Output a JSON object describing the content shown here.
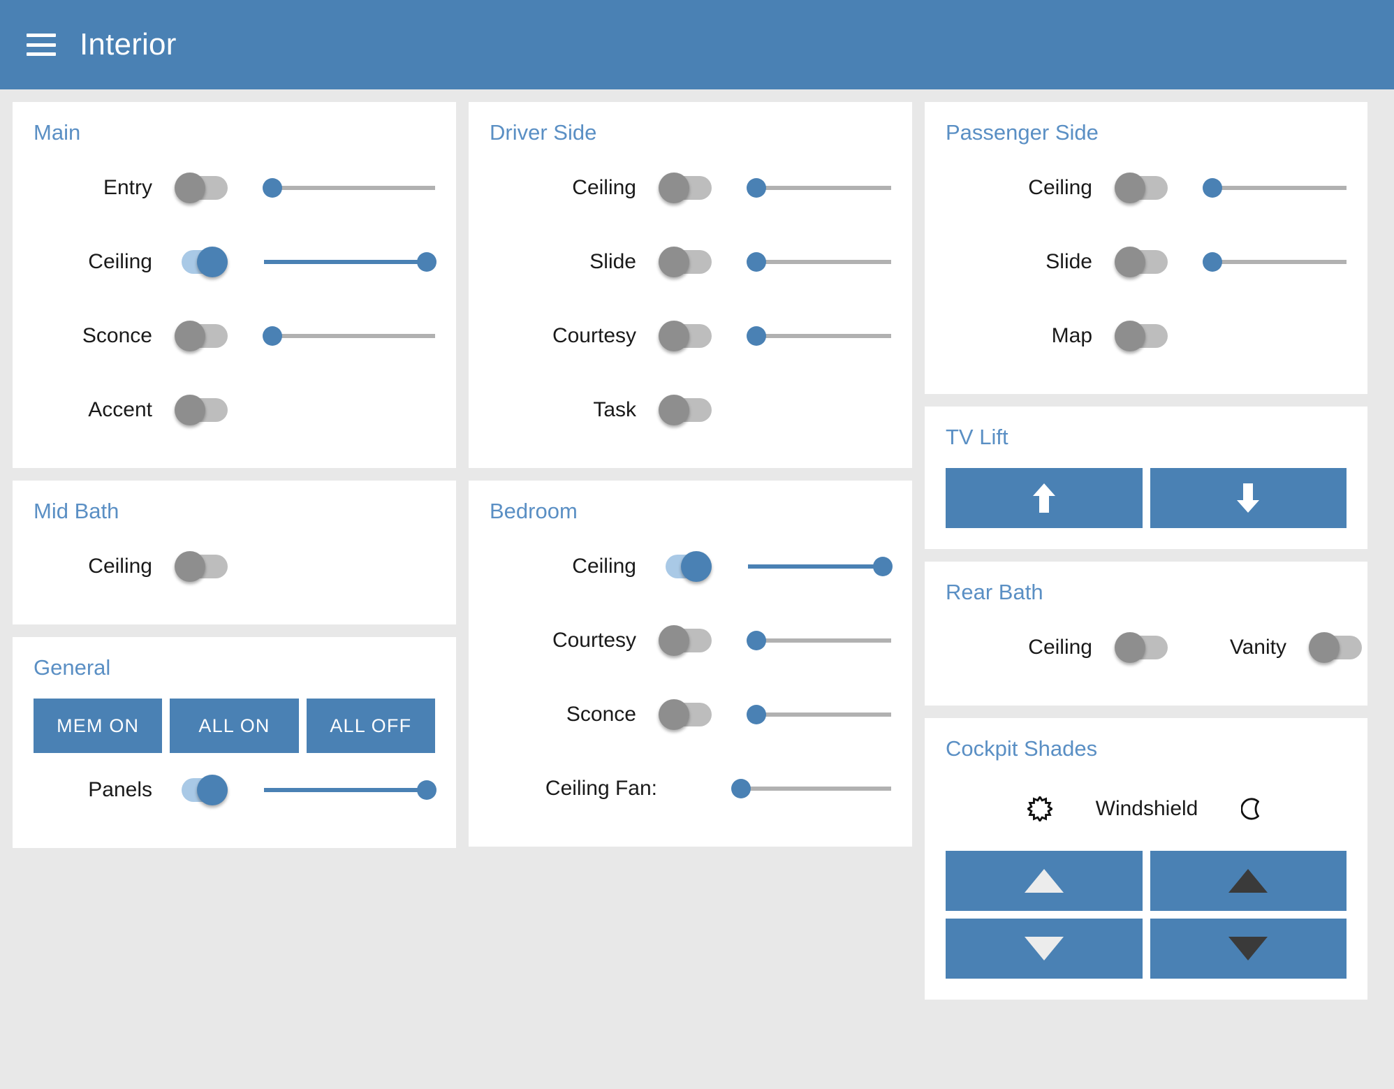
{
  "appbar": {
    "title": "Interior",
    "menu_icon": "hamburger-menu-icon",
    "background": "#4a81b4"
  },
  "theme": {
    "accent": "#4a81b4",
    "card_title_color": "#5a8fc4",
    "page_background": "#e8e8e8",
    "card_background": "#ffffff",
    "toggle_off_knob": "#8e8e8e",
    "toggle_off_track": "#bdbdbd",
    "toggle_on_knob": "#4a81b4",
    "toggle_on_track": "#a9c9e6",
    "slider_track": "#b1b1b1"
  },
  "cards": {
    "main": {
      "title": "Main",
      "rows": [
        {
          "label": "Entry",
          "toggle": "off",
          "toggle_state_text": "off",
          "slider": "min",
          "slider_value": 0
        },
        {
          "label": "Ceiling",
          "toggle": "on",
          "toggle_state_text": "on",
          "slider": "max",
          "slider_value": 100
        },
        {
          "label": "Sconce",
          "toggle": "off",
          "toggle_state_text": "off",
          "slider": "min",
          "slider_value": 0
        },
        {
          "label": "Accent",
          "toggle": "off",
          "toggle_state_text": "off",
          "slider": "none",
          "slider_value": null
        }
      ]
    },
    "mid_bath": {
      "title": "Mid Bath",
      "rows": [
        {
          "label": "Ceiling",
          "toggle": "off",
          "toggle_state_text": "off",
          "slider": "none",
          "slider_value": null
        }
      ]
    },
    "general": {
      "title": "General",
      "buttons": [
        {
          "label": "MEM ON"
        },
        {
          "label": "ALL ON"
        },
        {
          "label": "ALL OFF"
        }
      ],
      "rows": [
        {
          "label": "Panels",
          "toggle": "on",
          "toggle_state_text": "on",
          "slider": "max",
          "slider_value": 100
        }
      ]
    },
    "driver_side": {
      "title": "Driver Side",
      "rows": [
        {
          "label": "Ceiling",
          "toggle": "off",
          "toggle_state_text": "off",
          "slider": "min",
          "slider_value": 0
        },
        {
          "label": "Slide",
          "toggle": "off",
          "toggle_state_text": "off",
          "slider": "min",
          "slider_value": 0
        },
        {
          "label": "Courtesy",
          "toggle": "off",
          "toggle_state_text": "off",
          "slider": "min",
          "slider_value": 0
        },
        {
          "label": "Task",
          "toggle": "off",
          "toggle_state_text": "off",
          "slider": "none",
          "slider_value": null
        }
      ]
    },
    "bedroom": {
      "title": "Bedroom",
      "rows": [
        {
          "label": "Ceiling",
          "toggle": "on",
          "toggle_state_text": "on",
          "slider": "max",
          "slider_value": 100
        },
        {
          "label": "Courtesy",
          "toggle": "off",
          "toggle_state_text": "off",
          "slider": "min",
          "slider_value": 0
        },
        {
          "label": "Sconce",
          "toggle": "off",
          "toggle_state_text": "off",
          "slider": "min",
          "slider_value": 0
        },
        {
          "label": "Ceiling Fan:",
          "toggle": "none",
          "toggle_state_text": "",
          "slider": "min",
          "slider_value": 0
        }
      ]
    },
    "passenger_side": {
      "title": "Passenger Side",
      "rows": [
        {
          "label": "Ceiling",
          "toggle": "off",
          "toggle_state_text": "off",
          "slider": "min",
          "slider_value": 0
        },
        {
          "label": "Slide",
          "toggle": "off",
          "toggle_state_text": "off",
          "slider": "min",
          "slider_value": 0
        },
        {
          "label": "Map",
          "toggle": "off",
          "toggle_state_text": "off",
          "slider": "none",
          "slider_value": null
        }
      ]
    },
    "tv_lift": {
      "title": "TV Lift",
      "buttons": [
        {
          "icon": "arrow-up-icon",
          "glyph": "⬆"
        },
        {
          "icon": "arrow-down-icon",
          "glyph": "⬇"
        }
      ]
    },
    "rear_bath": {
      "title": "Rear Bath",
      "rows": [
        {
          "label": "Ceiling",
          "toggle": "off",
          "toggle_state_text": "off"
        },
        {
          "label": "Vanity",
          "toggle": "off",
          "toggle_state_text": "off"
        }
      ]
    },
    "cockpit_shades": {
      "title": "Cockpit Shades",
      "header": {
        "sun_icon": "sun-icon",
        "label": "Windshield",
        "moon_icon": "moon-icon"
      },
      "buttons": [
        {
          "icon": "triangle-up-light-icon",
          "position": "top-left"
        },
        {
          "icon": "triangle-up-dark-icon",
          "position": "top-right"
        },
        {
          "icon": "triangle-down-light-icon",
          "position": "bottom-left"
        },
        {
          "icon": "triangle-down-dark-icon",
          "position": "bottom-right"
        }
      ]
    }
  }
}
